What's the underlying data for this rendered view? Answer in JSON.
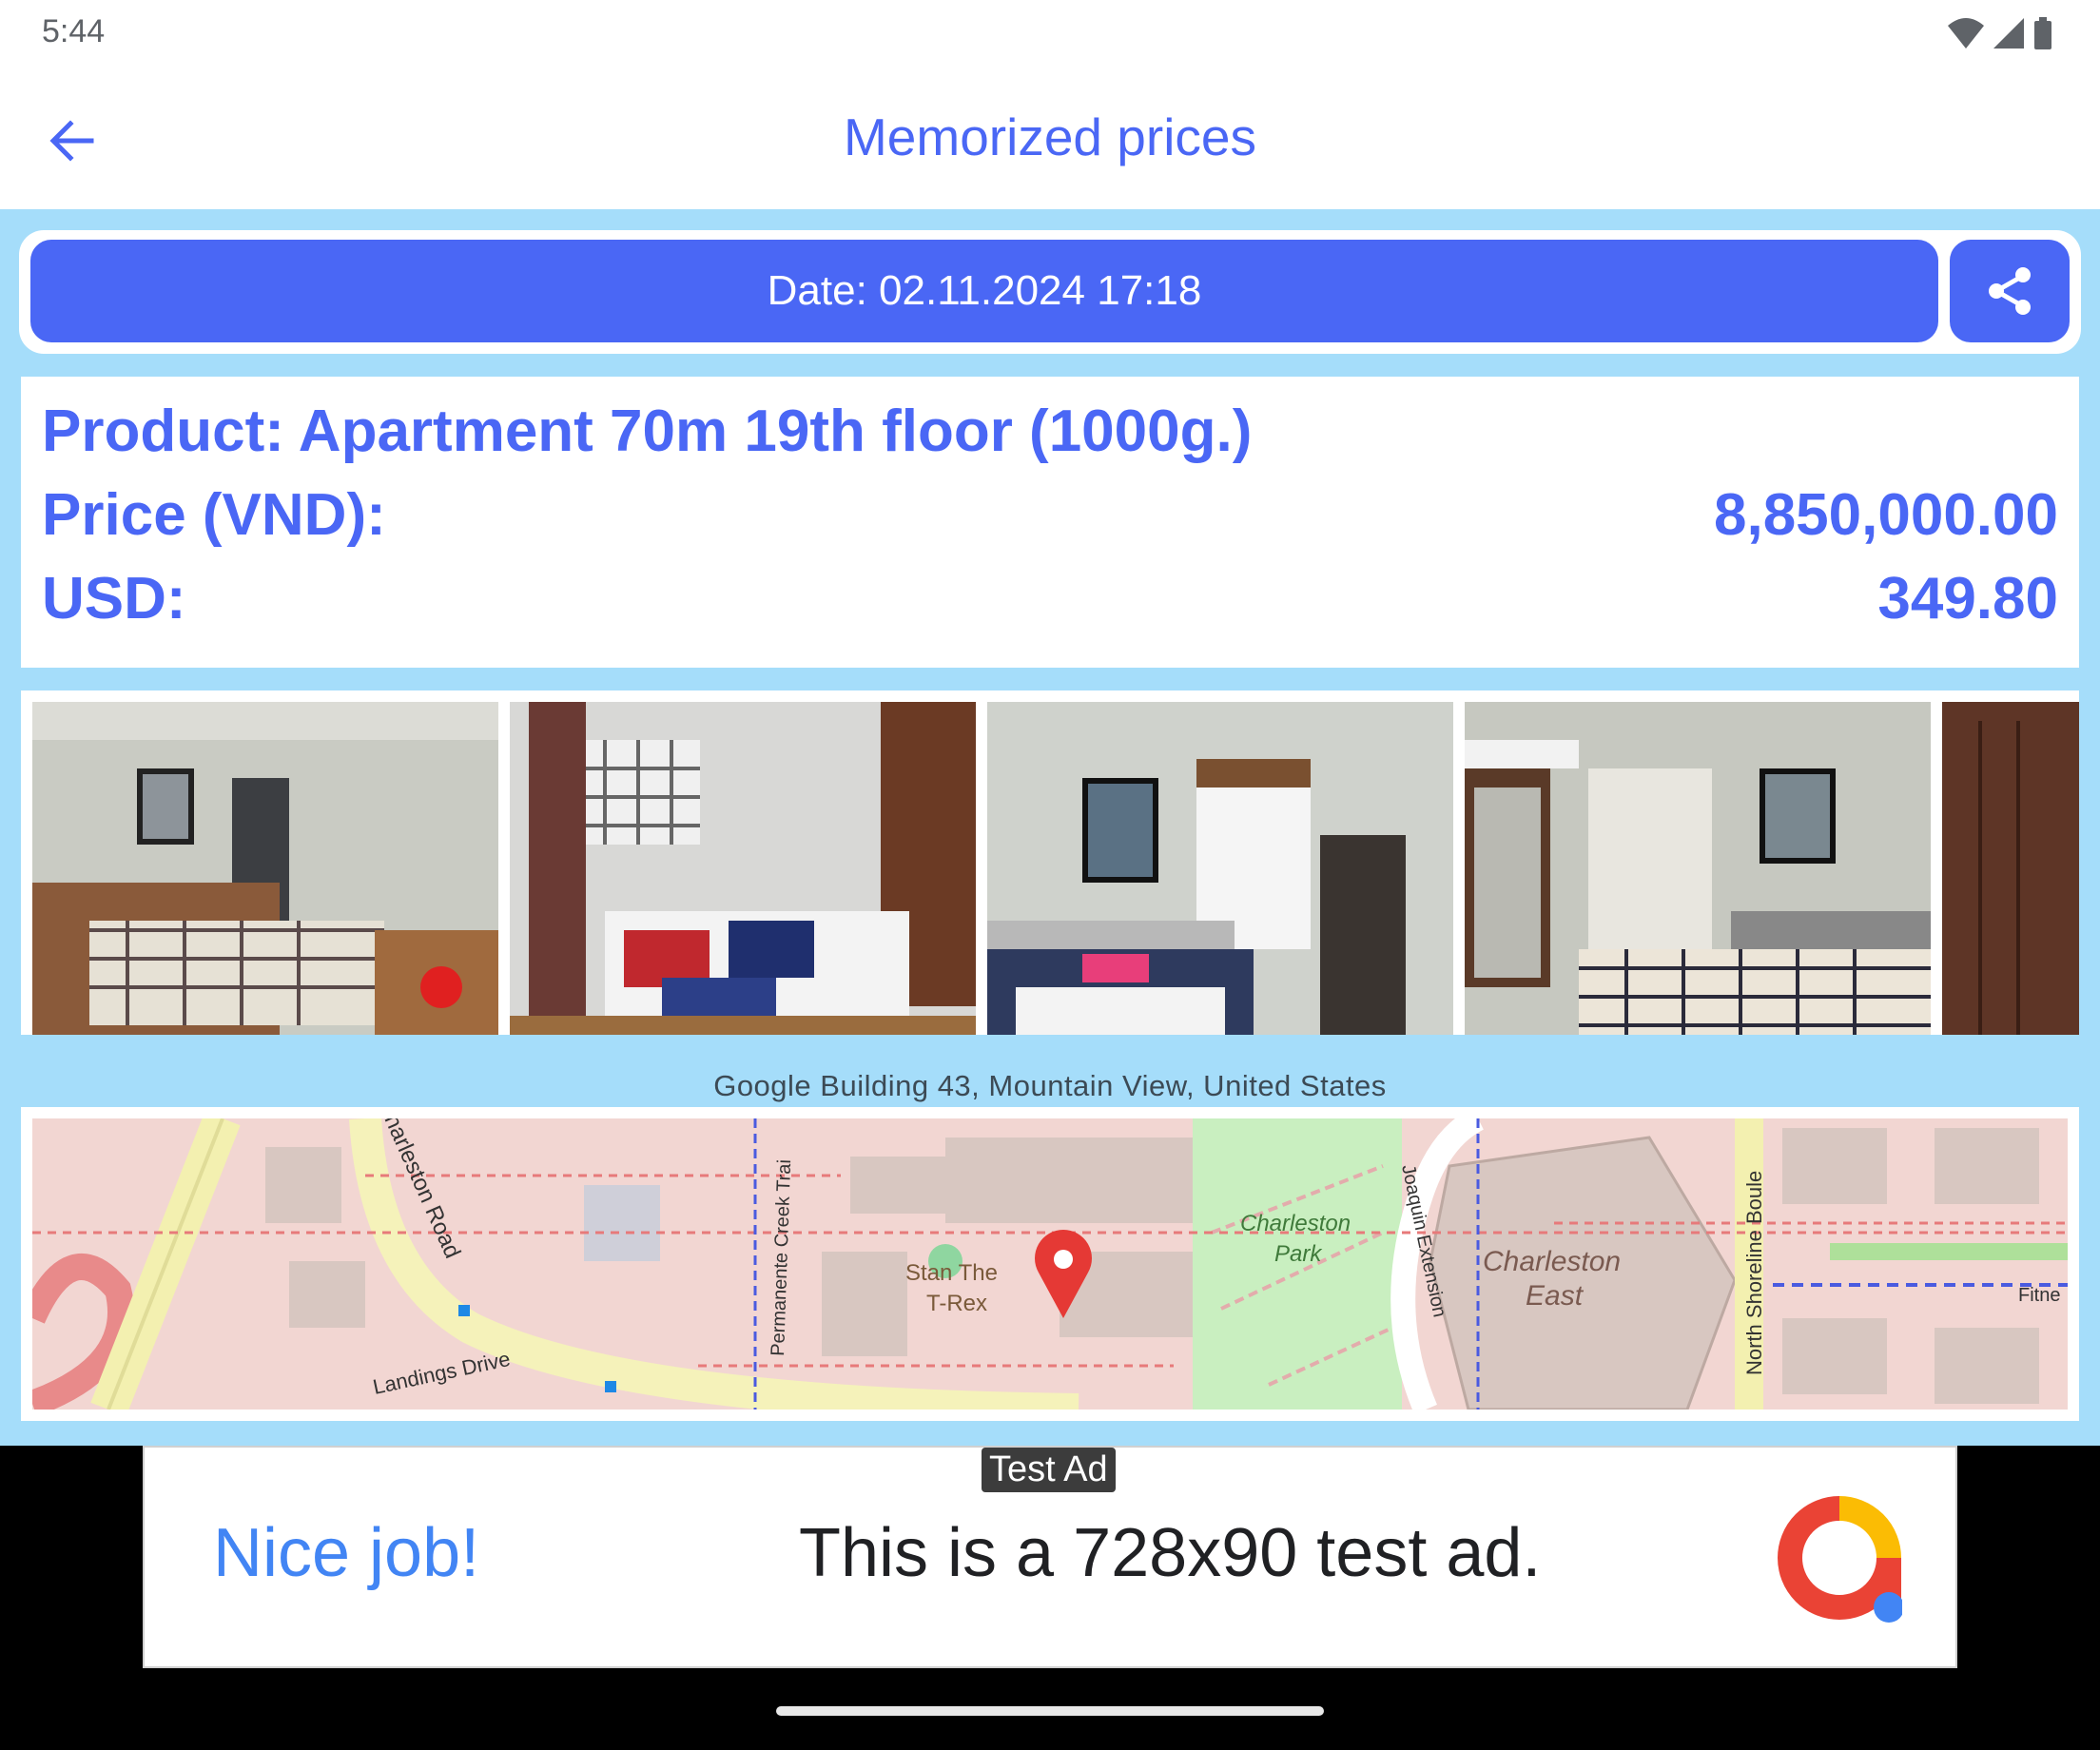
{
  "status_bar": {
    "time": "5:44"
  },
  "app_bar": {
    "title": "Memorized prices"
  },
  "date_card": {
    "date_label": "Date: 02.11.2024 17:18"
  },
  "info": {
    "product_label": "Product: Apartment 70m 19th floor (1000g.)",
    "price_label": "Price (VND):",
    "price_value": "8,850,000.00",
    "usd_label": "USD:",
    "usd_value": "349.80"
  },
  "location": {
    "address": "Google Building 43, Mountain View, United States"
  },
  "map_labels": {
    "road_charleston": "harleston Road",
    "landings_drive": "Landings Drive",
    "permanente": "Permanente Creek Trai",
    "stan": "Stan The",
    "trex": "T-Rex",
    "park1": "Charleston",
    "park2": "Park",
    "joaquin": "Joaquin Extension",
    "east1": "Charleston",
    "east2": "East",
    "shoreline": "North Shoreline Boule",
    "fitness": "Fitne"
  },
  "ad": {
    "badge": "Test Ad",
    "headline": "Nice job!",
    "body": "This is a 728x90 test ad."
  },
  "colors": {
    "accent": "#4a67f5",
    "background": "#a5ddfa",
    "map_pin": "#e53935"
  },
  "icons": [
    "back-arrow-icon",
    "share-icon",
    "wifi-icon",
    "signal-icon",
    "battery-icon",
    "map-pin-icon",
    "adsense-logo"
  ]
}
